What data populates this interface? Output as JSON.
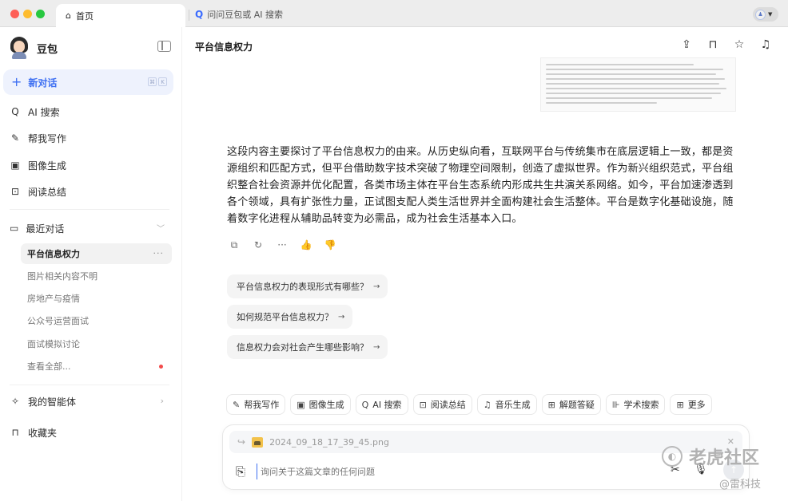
{
  "browser": {
    "home_tab_icon": "home-icon",
    "home_tab_label": "首页",
    "search_tab_icon": "search-q-icon",
    "search_tab_label": "问问豆包或 AI 搜索",
    "profile_icon": "user-avatar-icon"
  },
  "sidebar": {
    "brand_name": "豆包",
    "new_chat_label": "新对话",
    "nav": [
      {
        "label": "AI 搜索",
        "icon": "ai-search-icon"
      },
      {
        "label": "帮我写作",
        "icon": "pen-icon"
      },
      {
        "label": "图像生成",
        "icon": "image-icon"
      },
      {
        "label": "阅读总结",
        "icon": "read-summary-icon"
      }
    ],
    "recent_label": "最近对话",
    "conversations": [
      {
        "label": "平台信息权力",
        "active": true
      },
      {
        "label": "图片相关内容不明"
      },
      {
        "label": "房地产与疫情"
      },
      {
        "label": "公众号运营面试"
      },
      {
        "label": "面试模拟讨论"
      },
      {
        "label": "查看全部..."
      }
    ],
    "agents_label": "我的智能体",
    "favorites_label": "收藏夹"
  },
  "main": {
    "title": "平台信息权力",
    "answer_text": "这段内容主要探讨了平台信息权力的由来。从历史纵向看，互联网平台与传统集市在底层逻辑上一致，都是资源组织和匹配方式，但平台借助数字技术突破了物理空间限制，创造了虚拟世界。作为新兴组织范式，平台组织整合社会资源并优化配置，各类市场主体在平台生态系统内形成共生共演关系网络。如今，平台加速渗透到各个领域，具有扩张性力量，正试图支配人类生活世界并全面构建社会生活整体。平台是数字化基础设施，随着数字化进程从辅助品转变为必需品，成为社会生活基本入口。",
    "suggestions": [
      "平台信息权力的表现形式有哪些？",
      "如何规范平台信息权力？",
      "信息权力会对社会产生哪些影响？"
    ],
    "tools": [
      {
        "label": "帮我写作",
        "icon": "pen-icon"
      },
      {
        "label": "图像生成",
        "icon": "image-icon"
      },
      {
        "label": "AI 搜索",
        "icon": "ai-search-icon"
      },
      {
        "label": "阅读总结",
        "icon": "read-summary-icon"
      },
      {
        "label": "音乐生成",
        "icon": "music-icon"
      },
      {
        "label": "解题答疑",
        "icon": "solve-icon"
      },
      {
        "label": "学术搜索",
        "icon": "academic-icon"
      },
      {
        "label": "更多",
        "icon": "grid-icon"
      }
    ],
    "attached_file": "2024_09_18_17_39_45.png",
    "input_placeholder": "询问关于这篇文章的任何问题"
  },
  "watermark": {
    "main": "老虎社区",
    "sub": "@雷科技"
  }
}
